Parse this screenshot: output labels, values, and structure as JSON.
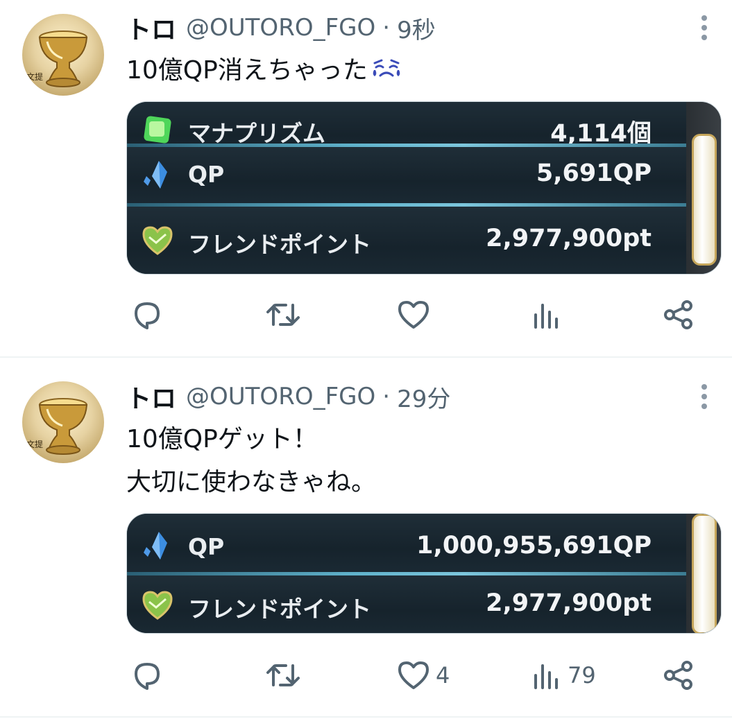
{
  "tweets": [
    {
      "name": "トロ",
      "handle": "@OUTORO_FGO",
      "separator": "·",
      "time": "9秒",
      "text_lines": [
        "10億QP消えちゃった"
      ],
      "emoji": "crying-face-icon",
      "card": {
        "rows": [
          {
            "icon": "mana-prism-icon",
            "label": "マナプリズム",
            "value": "4,114個"
          },
          {
            "icon": "qp-crystal-icon",
            "label": "QP",
            "value": "5,691QP"
          },
          {
            "icon": "friend-point-icon",
            "label": "フレンドポイント",
            "value": "2,977,900pt"
          }
        ]
      },
      "actions": {
        "reply": {
          "icon": "reply-icon",
          "count": ""
        },
        "retweet": {
          "icon": "retweet-icon",
          "count": ""
        },
        "like": {
          "icon": "heart-icon",
          "count": ""
        },
        "views": {
          "icon": "views-icon",
          "count": ""
        },
        "share": {
          "icon": "share-icon"
        }
      }
    },
    {
      "name": "トロ",
      "handle": "@OUTORO_FGO",
      "separator": "·",
      "time": "29分",
      "text_lines": [
        "10億QPゲット！",
        "大切に使わなきゃね。"
      ],
      "card": {
        "rows": [
          {
            "icon": "qp-crystal-icon",
            "label": "QP",
            "value": "1,000,955,691QP"
          },
          {
            "icon": "friend-point-icon",
            "label": "フレンドポイント",
            "value": "2,977,900pt"
          }
        ]
      },
      "actions": {
        "reply": {
          "icon": "reply-icon",
          "count": ""
        },
        "retweet": {
          "icon": "retweet-icon",
          "count": ""
        },
        "like": {
          "icon": "heart-icon",
          "count": "4"
        },
        "views": {
          "icon": "views-icon",
          "count": "79"
        },
        "share": {
          "icon": "share-icon"
        }
      }
    }
  ],
  "avatar_caption": "文提",
  "colors": {
    "text": "#0f1419",
    "secondary": "#536471",
    "divider": "#eff3f4",
    "card_bg": "#1c2a33",
    "row_line": "#5fb2cb"
  }
}
